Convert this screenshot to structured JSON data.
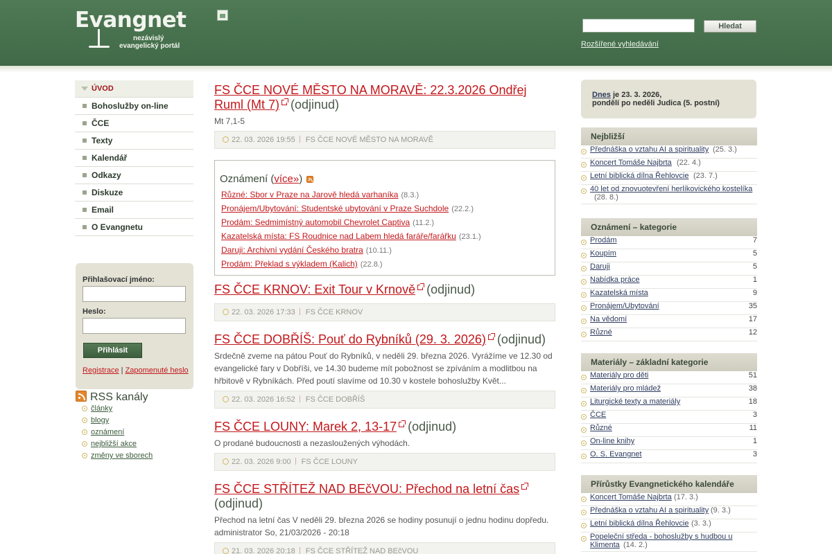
{
  "header": {
    "logo_text": "Evangnet",
    "logo_sub1": "nezávislý",
    "logo_sub2": "evangelický portál",
    "search_button": "Hledat",
    "advanced_search": "Rozšířené vyhledávání"
  },
  "nav": {
    "items": [
      {
        "label": "ÚVOD"
      },
      {
        "label": "Bohoslužby on-line"
      },
      {
        "label": "ČCE"
      },
      {
        "label": "Texty"
      },
      {
        "label": "Kalendář"
      },
      {
        "label": "Odkazy"
      },
      {
        "label": "Diskuze"
      },
      {
        "label": "Email"
      },
      {
        "label": "O Evangnetu"
      }
    ]
  },
  "login": {
    "username_label": "Přihlašovací jméno:",
    "password_label": "Heslo:",
    "button": "Přihlásit",
    "register": "Registrace",
    "separator": "|",
    "forgot": "Zapomenuté heslo"
  },
  "rss": {
    "title": "RSS kanály",
    "links": [
      "články",
      "blogy",
      "oznámení",
      "nejbližší akce",
      "změny ve sborech"
    ]
  },
  "articles": [
    {
      "title": "FS ČCE NOVÉ MĚSTO NA MORAVĚ: 22.3.2026 Ondřej Ruml (Mt 7)",
      "suffix": "(odjinud)",
      "text": "Mt 7,1-5",
      "date": "22. 03. 2026 19:55",
      "source": "FS ČCE NOVÉ MĚSTO NA MORAVĚ"
    },
    {
      "title": "FS ČCE KRNOV: Exit Tour v Krnově",
      "suffix": "(odjinud)",
      "text": "",
      "date": "22. 03. 2026 17:33",
      "source": "FS ČCE KRNOV"
    },
    {
      "title": "FS ČCE DOBŘÍŠ: Pouť do Rybníků (29. 3. 2026)",
      "suffix": "(odjinud)",
      "text": "Srdečně zveme na pátou Pouť do Rybníků, v neděli 29. března 2026. Vyrážíme ve 12.30 od evangelické fary v Dobříši, ve 14.30 budeme mít pobožnost se zpíváním a modlitbou na hřbitově v Rybníkách. Před poutí slavíme od 10.30 v kostele bohoslužby Květ...",
      "date": "22. 03. 2026 16:52",
      "source": "FS ČCE DOBŘÍŠ"
    },
    {
      "title": "FS ČCE LOUNY: Marek 2, 13-17",
      "suffix": "(odjinud)",
      "text": "O prodané budoucnosti a nezasloužených výhodách.",
      "date": "22. 03. 2026 9:00",
      "source": "FS ČCE LOUNY"
    },
    {
      "title": "FS ČCE STŘÍTEŽ NAD BEčVOU: Přechod na letní čas",
      "suffix": "(odjinud)",
      "text": "Přechod na letní čas V neděli 29. března 2026 se hodiny posunují o jednu hodinu dopředu. administrator So, 21/03/2026 - 20:18",
      "date": "21. 03. 2026 20:18",
      "source": "FS ČCE STŘÍTEŽ NAD BEčVOU"
    }
  ],
  "announcements": {
    "head": "Oznámení",
    "more": "více»",
    "items": [
      {
        "label": "Různé: Sbor v Praze na Jarově hledá varhaníka",
        "date": "(8.3.)"
      },
      {
        "label": "Pronájem/Ubytování: Studentské ubytování v Praze Suchdole",
        "date": "(22.2.)"
      },
      {
        "label": "Prodám: Sedmimístný automobil Chevrolet Captiva",
        "date": "(11.2.)"
      },
      {
        "label": "Kazatelská místa: FS Roudnice nad Labem hledá faráře/farářku",
        "date": "(23.1.)"
      },
      {
        "label": "Daruji: Archivní vydání Českého bratra",
        "date": "(10.11.)"
      },
      {
        "label": "Prodám: Překlad s výkladem (Kalich)",
        "date": "(22.8.)"
      }
    ]
  },
  "today": {
    "link": "Dnes",
    "text1": "je 23. 3. 2026,",
    "text2": "pondělí po neděli Judica (5. postní)"
  },
  "nejblizsi": {
    "head": "Nejbližší",
    "items": [
      {
        "label": "Přednáška o vztahu AI a spirituality",
        "date": "(25. 3.)"
      },
      {
        "label": "Koncert Tomáše Najbrta",
        "date": "(22. 4.)"
      },
      {
        "label": "Letní biblická dílna Řehlovcie",
        "date": "(23. 7.)"
      },
      {
        "label": "40 let od znovuotevření herlíkovického kostelíka",
        "date": "(28. 8.)"
      }
    ]
  },
  "oznameni_kategorie": {
    "head": "Oznámení – kategorie",
    "items": [
      {
        "label": "Prodám",
        "count": "7"
      },
      {
        "label": "Koupím",
        "count": "5"
      },
      {
        "label": "Daruji",
        "count": "5"
      },
      {
        "label": "Nabídka práce",
        "count": "1"
      },
      {
        "label": "Kazatelská místa",
        "count": "9"
      },
      {
        "label": "Pronájem/Ubytování",
        "count": "35"
      },
      {
        "label": "Na vědomí",
        "count": "17"
      },
      {
        "label": "Různé",
        "count": "12"
      }
    ]
  },
  "materialy": {
    "head": "Materiály – základní kategorie",
    "items": [
      {
        "label": "Materiály pro děti",
        "count": "51"
      },
      {
        "label": "Materiály pro mládež",
        "count": "38"
      },
      {
        "label": "Liturgické texty a materiály",
        "count": "18"
      },
      {
        "label": "ČCE",
        "count": "3"
      },
      {
        "label": "Různé",
        "count": "11"
      },
      {
        "label": "On-line knihy",
        "count": "1"
      },
      {
        "label": "O. S. Evangnet",
        "count": "3"
      }
    ]
  },
  "prirustky": {
    "head": "Přírůstky Evangnetického kalendáře",
    "items": [
      {
        "label": "Koncert Tomáše Najbrta",
        "date": "(17. 3.)"
      },
      {
        "label": "Přednáška o vztahu AI a spirituality",
        "date": "(9. 3.)"
      },
      {
        "label": "Letní biblická dílna Řehlovcie",
        "date": "(3. 3.)"
      },
      {
        "label": "Popeleční středa - bohoslužby s hudbou u Klimenta",
        "date": "(14. 2.)"
      }
    ]
  }
}
